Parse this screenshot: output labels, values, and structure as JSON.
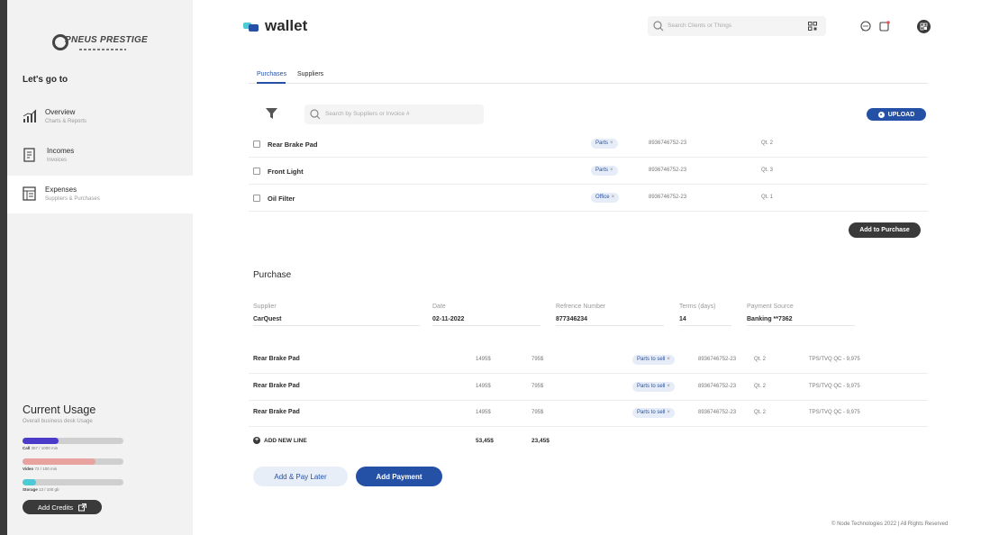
{
  "sidebar": {
    "logo_text": "PNEUS PRESTIGE",
    "logo_tagline": "· · · · · · · · ·",
    "goto_label": "Let's go to",
    "items": [
      {
        "title": "Overview",
        "subtitle": "Charts & Reports",
        "icon": "bar-chart-icon"
      },
      {
        "title": "Incomes",
        "subtitle": "Invoices",
        "icon": "invoice-icon"
      },
      {
        "title": "Expenses",
        "subtitle": "Suppliers & Purchases",
        "icon": "ledger-icon"
      }
    ],
    "usage": {
      "title": "Current Usage",
      "subtitle": "Overall business desk Usage",
      "bars": [
        {
          "label": "Call",
          "detail": "357 / 1000 min",
          "fraction": 0.357,
          "color": "#4a3cc8"
        },
        {
          "label": "Video",
          "detail": "72 / 100 min",
          "fraction": 0.72,
          "color": "#e8a3a0"
        },
        {
          "label": "Storage",
          "detail": "13 / 100 gb",
          "fraction": 0.13,
          "color": "#4ecad5"
        }
      ],
      "add_credits": "Add Credits"
    }
  },
  "header": {
    "title": "wallet",
    "search_placeholder": "Search Clients or Things"
  },
  "tabs": [
    {
      "label": "Purchases",
      "active": true
    },
    {
      "label": "Suppliers",
      "active": false
    }
  ],
  "toolbar": {
    "search_placeholder": "Search by Suppliers or Invoice #",
    "upload_label": "UPLOAD"
  },
  "products": [
    {
      "name": "Rear Brake Pad",
      "tag": "Parts",
      "serial": "8936746752-23",
      "qty": "Qt. 2"
    },
    {
      "name": "Front Light",
      "tag": "Parts",
      "serial": "8936746752-23",
      "qty": "Qt. 3"
    },
    {
      "name": "Oil Filter",
      "tag": "Office",
      "serial": "8936746752-23",
      "qty": "Qt. 1"
    }
  ],
  "add_to_purchase": "Add to Purchase",
  "purchase": {
    "title": "Purchase",
    "fields": [
      {
        "label": "Supplier",
        "value": "CarQuest"
      },
      {
        "label": "Date",
        "value": "02-11-2022"
      },
      {
        "label": "Refrence Number",
        "value": "877346234"
      },
      {
        "label": "Terms (days)",
        "value": "14"
      },
      {
        "label": "Payment Source",
        "value": "Banking **7362"
      }
    ],
    "lines": [
      {
        "name": "Rear Brake Pad",
        "price": "1495$",
        "cost": "795$",
        "tag": "Parts to sell",
        "serial": "8936746752-23",
        "qty": "Qt. 2",
        "tax": "TPS/TVQ QC - 9,975"
      },
      {
        "name": "Rear Brake Pad",
        "price": "1495$",
        "cost": "795$",
        "tag": "Parts to sell",
        "serial": "8936746752-23",
        "qty": "Qt. 2",
        "tax": "TPS/TVQ QC - 9,975"
      },
      {
        "name": "Rear Brake Pad",
        "price": "1495$",
        "cost": "795$",
        "tag": "Parts to sell",
        "serial": "8936746752-23",
        "qty": "Qt. 2",
        "tax": "TPS/TVQ QC - 9,975"
      }
    ],
    "add_line": "ADD NEW LINE",
    "total_price": "53,45$",
    "total_cost": "23,45$",
    "btn_later": "Add & Pay Later",
    "btn_pay": "Add Payment"
  },
  "footer": "© Node Technologies 2022 | All Rights Reserved",
  "colors": {
    "accent": "#2451a6",
    "dark": "#3a3a3a",
    "sidebar_bg": "#f2f2f2",
    "chip_bg": "#e6edf8"
  }
}
